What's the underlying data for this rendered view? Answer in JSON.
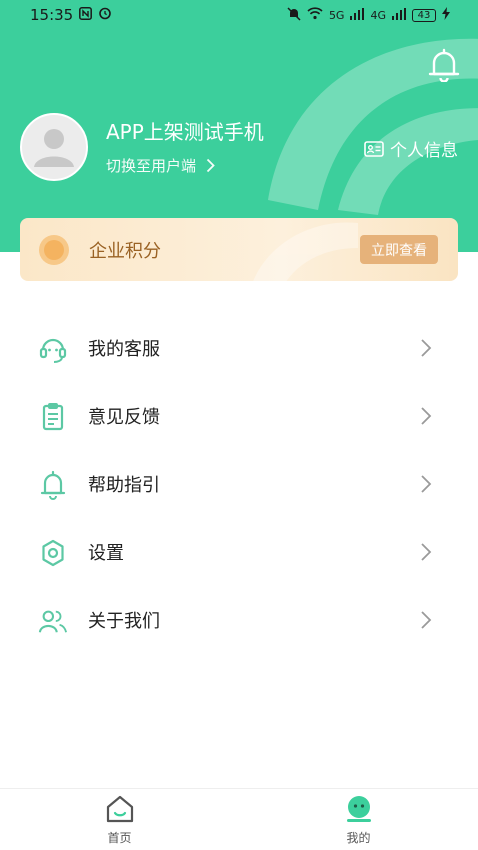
{
  "status_bar": {
    "time": "15:35",
    "network": "5G",
    "network2": "4G",
    "battery": "43"
  },
  "header": {
    "username": "APP上架测试手机",
    "switch_label": "切换至用户端",
    "personal_info_label": "个人信息"
  },
  "points_card": {
    "title": "企业积分",
    "button_label": "立即查看"
  },
  "menu": {
    "items": [
      {
        "label": "我的客服",
        "icon": "headset-icon"
      },
      {
        "label": "意见反馈",
        "icon": "clipboard-icon"
      },
      {
        "label": "帮助指引",
        "icon": "bell-icon"
      },
      {
        "label": "设置",
        "icon": "gear-icon"
      },
      {
        "label": "关于我们",
        "icon": "users-icon"
      }
    ]
  },
  "bottom_nav": {
    "tabs": [
      {
        "label": "首页",
        "icon": "home-icon"
      },
      {
        "label": "我的",
        "icon": "profile-face-icon"
      }
    ]
  },
  "colors": {
    "brand_green": "#3ccf9c",
    "icon_green": "#5cc8a4",
    "points_text": "#9a6224",
    "points_button": "#e6b27a"
  }
}
